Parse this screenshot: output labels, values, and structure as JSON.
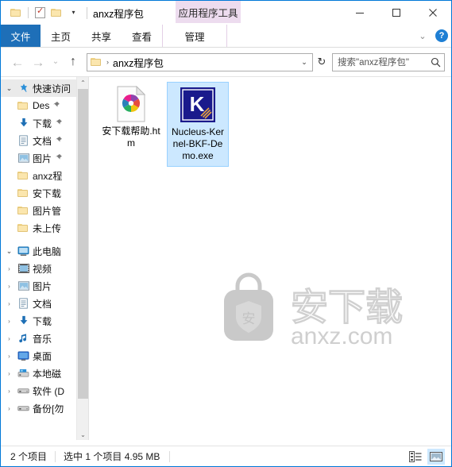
{
  "window": {
    "title": "anxz程序包",
    "contextual_tab": "应用程序工具",
    "controls": {
      "minimize": "minimize-icon",
      "maximize": "maximize-icon",
      "close": "close-icon"
    }
  },
  "quick_access_toolbar": {
    "items": [
      {
        "name": "folder-icon",
        "label": ""
      },
      {
        "name": "properties-icon",
        "label": ""
      },
      {
        "name": "new-folder-icon",
        "label": ""
      },
      {
        "name": "customize-caret",
        "label": "▾"
      }
    ]
  },
  "ribbon": {
    "tabs": [
      {
        "id": "file",
        "label": "文件",
        "active": true
      },
      {
        "id": "home",
        "label": "主页",
        "active": false
      },
      {
        "id": "share",
        "label": "共享",
        "active": false
      },
      {
        "id": "view",
        "label": "查看",
        "active": false
      },
      {
        "id": "manage",
        "label": "管理",
        "active": false
      }
    ],
    "collapse_caret": "⌄",
    "help_label": "?"
  },
  "address_bar": {
    "back": "←",
    "forward": "→",
    "recent": "⌄",
    "up": "↑",
    "breadcrumb_icon": "folder-icon",
    "breadcrumb_sep": "›",
    "breadcrumb": "anxz程序包",
    "dropdown": "⌄",
    "refresh": "↻"
  },
  "search": {
    "placeholder": "搜索\"anxz程序包\"",
    "icon": "search-icon"
  },
  "sidebar": {
    "groups": [
      {
        "name": "quick-access",
        "label": "快速访问",
        "icon": "star-pin-icon",
        "expanded": true,
        "items": [
          {
            "label": "Des",
            "icon": "folder-icon",
            "pinned": true
          },
          {
            "label": "下载",
            "icon": "downloads-icon",
            "pinned": true
          },
          {
            "label": "文档",
            "icon": "documents-icon",
            "pinned": true
          },
          {
            "label": "图片",
            "icon": "pictures-icon",
            "pinned": true
          },
          {
            "label": "anxz程",
            "icon": "folder-icon",
            "pinned": false
          },
          {
            "label": "安下载",
            "icon": "folder-icon",
            "pinned": false
          },
          {
            "label": "图片管",
            "icon": "folder-icon",
            "pinned": false
          },
          {
            "label": "未上传",
            "icon": "folder-icon",
            "pinned": false
          }
        ]
      },
      {
        "name": "this-pc",
        "label": "此电脑",
        "icon": "computer-icon",
        "expanded": true,
        "items": [
          {
            "label": "视频",
            "icon": "videos-icon",
            "pinned": false
          },
          {
            "label": "图片",
            "icon": "pictures-icon",
            "pinned": false
          },
          {
            "label": "文档",
            "icon": "documents-icon",
            "pinned": false
          },
          {
            "label": "下载",
            "icon": "downloads-icon",
            "pinned": false
          },
          {
            "label": "音乐",
            "icon": "music-icon",
            "pinned": false
          },
          {
            "label": "桌面",
            "icon": "desktop-icon",
            "pinned": false
          },
          {
            "label": "本地磁",
            "icon": "local-disk-icon",
            "pinned": false
          },
          {
            "label": "软件 (D",
            "icon": "drive-icon",
            "pinned": false
          },
          {
            "label": "备份[勿",
            "icon": "drive-icon",
            "pinned": false
          }
        ]
      }
    ],
    "scrollbar": {
      "up": "⌃",
      "down": "⌄"
    }
  },
  "files": {
    "items": [
      {
        "name": "安下载帮助.htm",
        "icon": "html-document-icon",
        "selected": false
      },
      {
        "name": "Nucleus-Kernel-BKF-Demo.exe",
        "icon": "application-exe-icon",
        "selected": true
      }
    ]
  },
  "watermark": {
    "brand": "安下载",
    "domain": "anxz.com",
    "shield_char": "安"
  },
  "status_bar": {
    "item_count": "2 个项目",
    "selection": "选中 1 个项目  4.95 MB",
    "views": [
      {
        "name": "details-view",
        "active": false
      },
      {
        "name": "large-icons-view",
        "active": true
      }
    ]
  },
  "colors": {
    "accent": "#1e6fb8",
    "selection": "#cce8ff",
    "contextual_tab": "#eddcef",
    "window_border": "#0078d7"
  }
}
